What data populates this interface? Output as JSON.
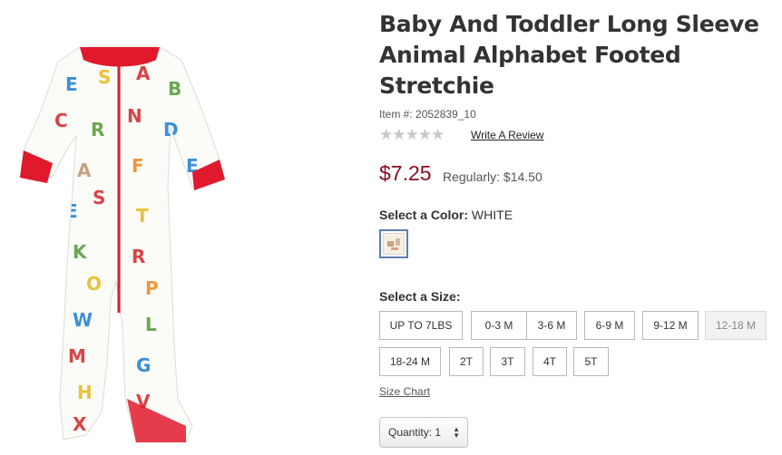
{
  "product": {
    "title": "Baby And Toddler Long Sleeve Animal Alphabet Footed Stretchie",
    "item_number": "Item #: 2052839_10",
    "rating_stars": "★★★★★",
    "review_link": "Write A Review",
    "price": "$7.25",
    "regular_label": "Regularly: $14.50"
  },
  "color": {
    "label": "Select a Color:",
    "value": "WHITE"
  },
  "size": {
    "label": "Select a Size:",
    "options": [
      {
        "label": "UP TO 7LBS",
        "available": true
      },
      {
        "label": "0-3 M",
        "available": true
      },
      {
        "label": "3-6 M",
        "available": true
      },
      {
        "label": "6-9 M",
        "available": true
      },
      {
        "label": "9-12 M",
        "available": true
      },
      {
        "label": "12-18 M",
        "available": false
      },
      {
        "label": "18-24 M",
        "available": true
      },
      {
        "label": "2T",
        "available": true
      },
      {
        "label": "3T",
        "available": true
      },
      {
        "label": "4T",
        "available": true
      },
      {
        "label": "5T",
        "available": true
      }
    ],
    "chart_link": "Size Chart"
  },
  "quantity": {
    "label": "Quantity: 1",
    "arrows": "▲▼"
  },
  "colors": {
    "price": "#8a0a1e",
    "trim": "#e0192c",
    "swatch_border": "#5b7fb0"
  }
}
